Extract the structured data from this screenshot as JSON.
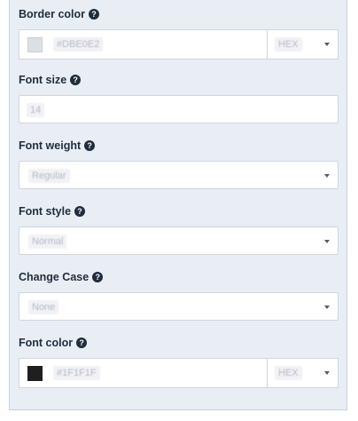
{
  "fields": {
    "border_color": {
      "label": "Border color",
      "value": "#DBE0E2",
      "swatch_color": "#dbe0e2",
      "format": "HEX"
    },
    "font_size": {
      "label": "Font size",
      "value": "14"
    },
    "font_weight": {
      "label": "Font weight",
      "value": "Regular"
    },
    "font_style": {
      "label": "Font style",
      "value": "Normal"
    },
    "change_case": {
      "label": "Change Case",
      "value": "None"
    },
    "font_color": {
      "label": "Font color",
      "value": "#1F1F1F",
      "swatch_color": "#1f1f1f",
      "format": "HEX"
    }
  },
  "icons": {
    "help": "?"
  }
}
